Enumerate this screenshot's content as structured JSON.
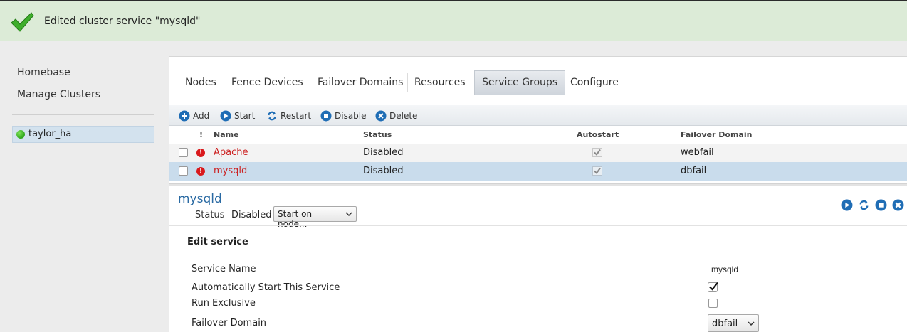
{
  "notification": {
    "message": "Edited cluster service \"mysqld\""
  },
  "sidebar": {
    "nav": [
      {
        "label": "Homebase"
      },
      {
        "label": "Manage Clusters"
      }
    ],
    "clusters": [
      {
        "label": "taylor_ha",
        "status_color": "#3cb92a"
      }
    ]
  },
  "tabs": [
    {
      "label": "Nodes"
    },
    {
      "label": "Fence Devices"
    },
    {
      "label": "Failover Domains"
    },
    {
      "label": "Resources"
    },
    {
      "label": "Service Groups",
      "active": true
    },
    {
      "label": "Configure"
    }
  ],
  "toolbar": {
    "add": "Add",
    "start": "Start",
    "restart": "Restart",
    "disable": "Disable",
    "delete": "Delete"
  },
  "table": {
    "columns": {
      "flag": "!",
      "name": "Name",
      "status": "Status",
      "autostart": "Autostart",
      "failover": "Failover Domain"
    },
    "rows": [
      {
        "name": "Apache",
        "status": "Disabled",
        "autostart": true,
        "failover": "webfail",
        "selected": false
      },
      {
        "name": "mysqld",
        "status": "Disabled",
        "autostart": true,
        "failover": "dbfail",
        "selected": true
      }
    ]
  },
  "detail": {
    "title": "mysqld",
    "status_label": "Status",
    "status_value": "Disabled",
    "start_select": "Start on node...",
    "icons": [
      "start-icon",
      "restart-icon",
      "disable-icon",
      "delete-icon"
    ]
  },
  "edit": {
    "title": "Edit service",
    "service_name_label": "Service Name",
    "service_name_value": "mysqld",
    "autostart_label": "Automatically Start This Service",
    "autostart_checked": true,
    "exclusive_label": "Run Exclusive",
    "exclusive_checked": false,
    "failover_label": "Failover Domain",
    "failover_value": "dbfail"
  },
  "colors": {
    "accent_blue": "#2a6aa3",
    "error_red": "#d9191c",
    "notice_bg": "#dcebd7"
  }
}
